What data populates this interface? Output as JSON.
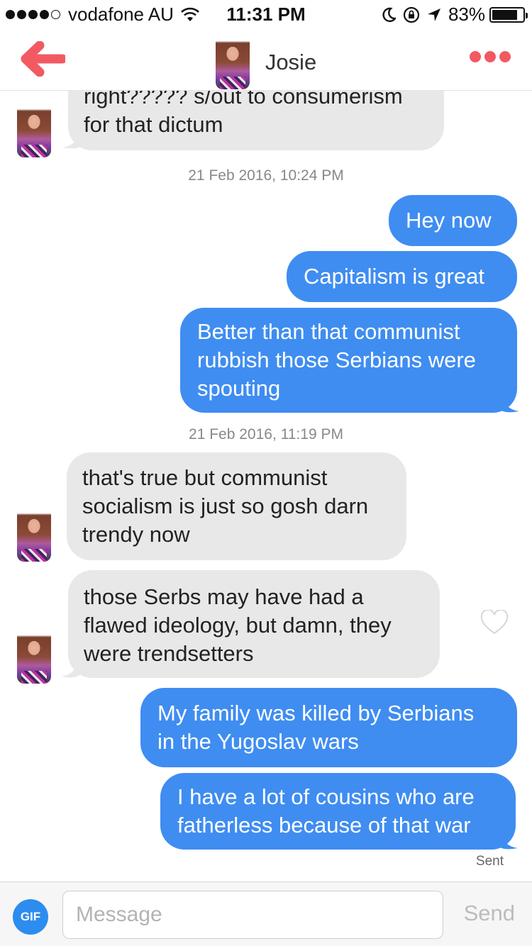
{
  "status_bar": {
    "carrier": "vodafone AU",
    "time": "11:31 PM",
    "battery_percent": "83%",
    "battery_level": 0.83,
    "signal_bars_filled": 4,
    "signal_bars_total": 5
  },
  "header": {
    "name": "Josie",
    "accent_color": "#f25a62"
  },
  "messages": [
    {
      "from": "them",
      "lines": [
        "right????? s/out to consumerism",
        "for that dictum"
      ]
    },
    {
      "type": "timestamp",
      "text": "21 Feb 2016, 10:24 PM"
    },
    {
      "from": "me",
      "lines": [
        "Hey now"
      ]
    },
    {
      "from": "me",
      "lines": [
        "Capitalism is great"
      ]
    },
    {
      "from": "me",
      "lines": [
        "Better than that communist",
        "rubbish those Serbians were",
        "spouting"
      ]
    },
    {
      "type": "timestamp",
      "text": "21 Feb 2016, 11:19 PM"
    },
    {
      "from": "them",
      "lines": [
        "that's true but communist",
        "socialism is just so gosh darn",
        "trendy now"
      ]
    },
    {
      "from": "them",
      "lines": [
        "those Serbs may have had a",
        "flawed ideology, but damn, they",
        "were trendsetters"
      ]
    },
    {
      "from": "me",
      "lines": [
        "My family was killed by Serbians",
        "in the Yugoslav wars"
      ]
    },
    {
      "from": "me",
      "lines": [
        "I have a lot of cousins who are",
        "fatherless because of that war"
      ]
    }
  ],
  "sent_status": "Sent",
  "composer": {
    "gif_label": "GIF",
    "placeholder": "Message",
    "send_label": "Send"
  },
  "colors": {
    "outgoing_bubble": "#3f8df1",
    "incoming_bubble": "#e8e8e8",
    "gif_button": "#2d8cf0"
  },
  "icons": [
    "back-arrow-icon",
    "more-dots-icon",
    "heart-icon",
    "wifi-icon",
    "moon-icon",
    "rotation-lock-icon",
    "location-arrow-icon",
    "battery-icon"
  ]
}
